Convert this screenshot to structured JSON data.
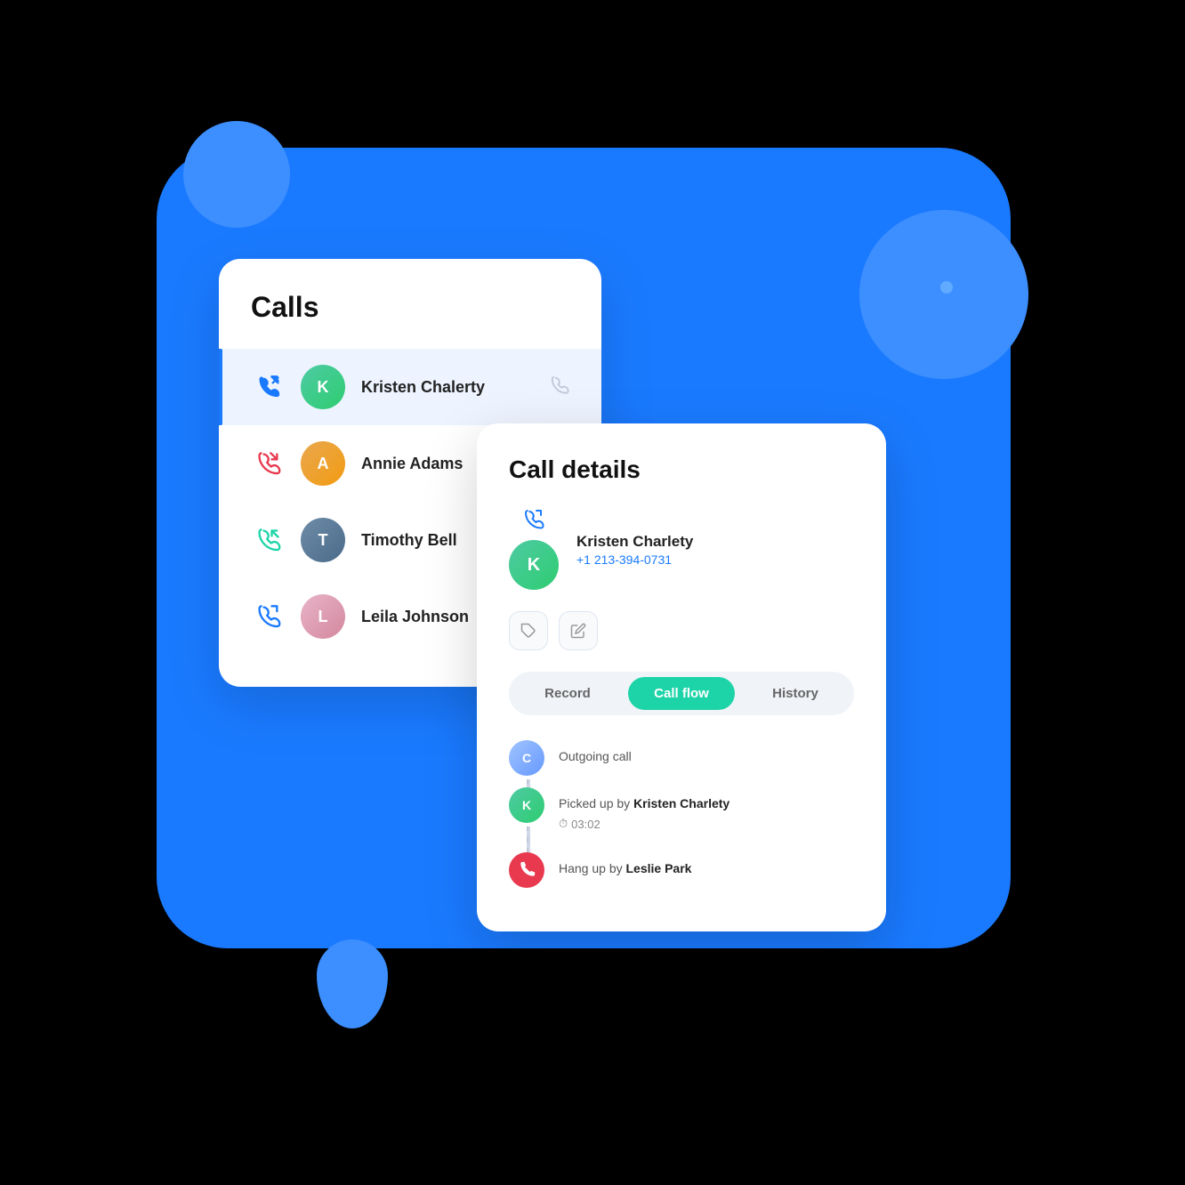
{
  "scene": {
    "bg_color": "#1a7aff"
  },
  "calls_card": {
    "title": "Calls",
    "items": [
      {
        "name": "Kristen Chalerty",
        "call_type": "outgoing",
        "call_color": "#1a7aff",
        "active": true
      },
      {
        "name": "Annie Adams",
        "call_type": "incoming-missed",
        "call_color": "#e8394f",
        "active": false
      },
      {
        "name": "Timothy Bell",
        "call_type": "incoming",
        "call_color": "#1dd4a8",
        "active": false
      },
      {
        "name": "Leila Johnson",
        "call_type": "outgoing",
        "call_color": "#1a7aff",
        "active": false
      }
    ]
  },
  "details_card": {
    "title": "Call details",
    "contact_name": "Kristen Charlety",
    "contact_phone": "+1 213-394-0731",
    "tabs": {
      "record": "Record",
      "call_flow": "Call flow",
      "history": "History",
      "active": "call_flow"
    },
    "action_buttons": {
      "tag": "🏷",
      "edit": "✏"
    },
    "timeline": [
      {
        "type": "outgoing",
        "text": "Outgoing call",
        "bold": ""
      },
      {
        "type": "pickup",
        "text": "Picked up by ",
        "bold": "Kristen Charlety",
        "duration": "03:02",
        "duration_icon": "⏱"
      },
      {
        "type": "hangup",
        "text": "Hang up by ",
        "bold": "Leslie Park"
      }
    ]
  }
}
